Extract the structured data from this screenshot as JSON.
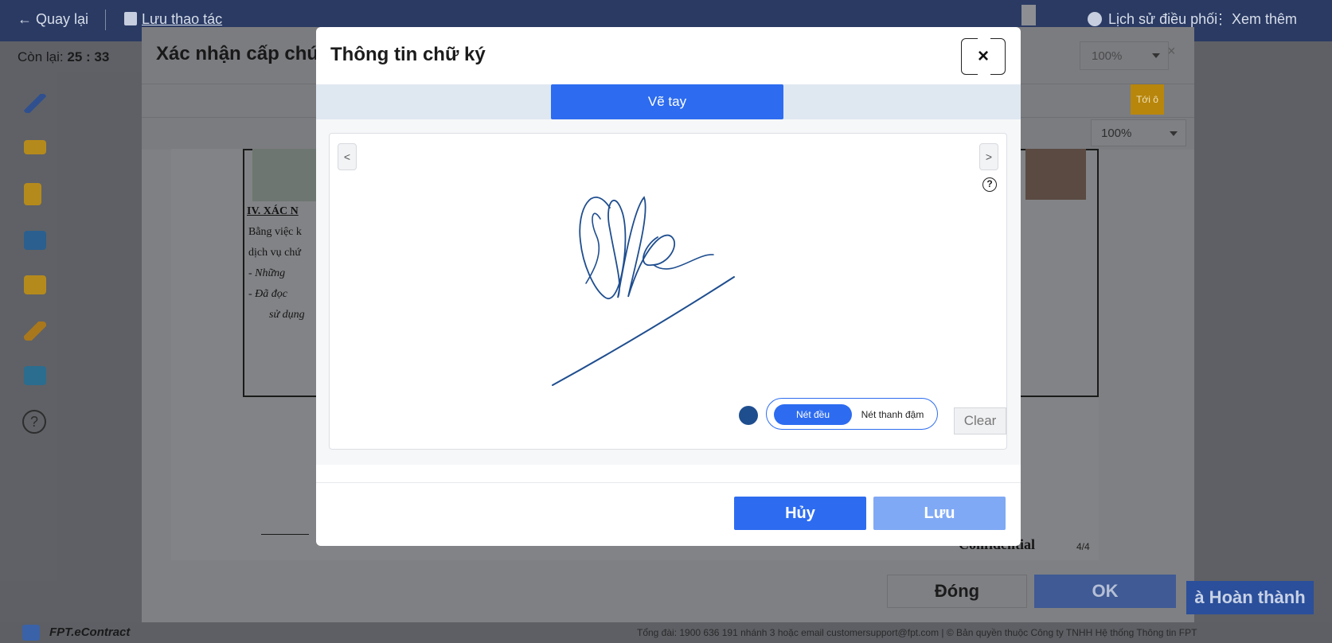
{
  "topbar": {
    "back_label": "← Quay lại",
    "save_label": "Lưu thao tác",
    "history_label": "Lịch sử điều phối",
    "more_label": "⋮ Xem thêm"
  },
  "timer": {
    "prefix": "Còn lại:",
    "value": "25 : 33"
  },
  "background_dialog": {
    "title": "Xác nhận cấp chứ",
    "close": "×",
    "zoom_top": "100%",
    "zoom_doc": "100%",
    "go_to_sign": "Tới ô ký",
    "close_button": "Đóng",
    "ok_button": "OK",
    "complete_button": "à Hoàn thành"
  },
  "document": {
    "section_title": "IV. XÁC N",
    "line1": "Bằng việc k",
    "line2": "dịch vụ chứ",
    "line3": "-   Những",
    "line4": "-   Đã đọc",
    "line5": "sử dụng",
    "confidential": "Confidential",
    "page": "4/4"
  },
  "footer": {
    "brand": "FPT.eContract",
    "info": "Tổng đài: 1900 636 191 nhánh 3 hoặc email customersupport@fpt.com  |  © Bản quyền thuộc Công ty TNHH Hệ thống Thông tin FPT"
  },
  "modal": {
    "title": "Thông tin chữ ký",
    "close_icon": "×",
    "tab_active": "Vẽ tay",
    "prev": "<",
    "next": ">",
    "help": "?",
    "ink_color": "#1f4e8f",
    "stroke_uniform": "Nét đều",
    "stroke_variable": "Nét thanh đậm",
    "clear_button": "Clear",
    "cancel_button": "Hủy",
    "save_button": "Lưu"
  },
  "colors": {
    "primary": "#2d6cf0",
    "primary_disabled": "#80a9f5",
    "topbar": "#2a3a63",
    "signature": "#1f4e8f"
  },
  "icons": {
    "pen": "pen-icon",
    "note": "note-icon",
    "doc": "document-icon",
    "stamp": "stamp-icon",
    "comment": "comment-icon",
    "pencil": "pencil-icon",
    "info": "info-icon",
    "help": "help-icon"
  }
}
